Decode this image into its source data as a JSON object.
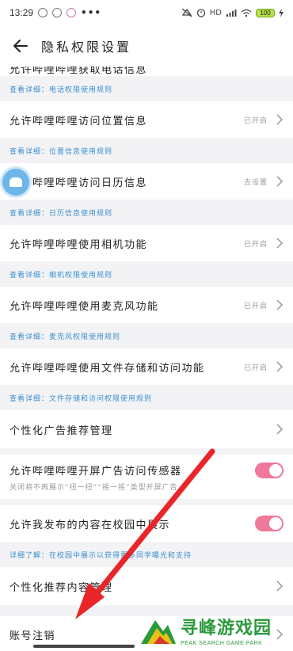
{
  "status_bar": {
    "time": "13:29",
    "dots": "•••",
    "network": "HD",
    "battery": "100"
  },
  "header": {
    "title": "隐私权限设置"
  },
  "partial_top": {
    "label": "允许哔哩哔哩获取电话信息",
    "detail": "查看详细：电话权限使用规则"
  },
  "items": [
    {
      "label": "允许哔哩哔哩访问位置信息",
      "status": "已开启",
      "detail": "查看详细：位置信息使用规则"
    },
    {
      "label": "允许哔哩哔哩访问日历信息",
      "status": "去设置",
      "detail": "查看详细：日历信息使用规则"
    },
    {
      "label": "允许哔哩哔哩使用相机功能",
      "status": "已开启",
      "detail": "查看详细：相机权限使用规则"
    },
    {
      "label": "允许哔哩哔哩使用麦克风功能",
      "status": "已开启",
      "detail": "查看详细：麦克风权限使用规则"
    },
    {
      "label": "允许哔哩哔哩使用文件存储和访问功能",
      "status": "已开启",
      "detail": "查看详细：文件存储和访问权限使用规则"
    }
  ],
  "ad_management": {
    "label": "个性化广告推荐管理"
  },
  "sensor": {
    "label": "允许哔哩哔哩开屏广告访问传感器",
    "subtext": "关闭将不再展示“扭一扭”“摇一摇”类型开屏广告"
  },
  "campus": {
    "label": "允许我发布的内容在校园中展示",
    "detail": "详细了解：在校园中展示以获得更多同学曝光和支持"
  },
  "content_management": {
    "label": "个性化推荐内容管理"
  },
  "account_cancel": {
    "label": "账号注销"
  },
  "watermark": {
    "title": "寻峰游戏园",
    "subtitle": "PEAK SEARCH GAME PARK"
  },
  "colors": {
    "accent": "#f0789a",
    "link": "#3a8ed0",
    "arrow": "#e8262a"
  }
}
